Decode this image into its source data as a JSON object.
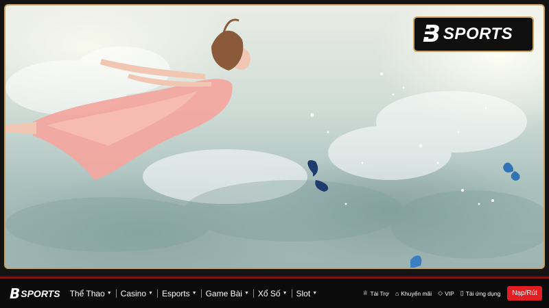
{
  "brand": {
    "mark": "B",
    "name": "SPORTS"
  },
  "hero": {
    "image": "woman-floating-in-clouds-with-butterflies",
    "accent_border": "#c9a35a"
  },
  "nav": {
    "menu": [
      {
        "label": "Thể Thao",
        "has_dropdown": true
      },
      {
        "label": "Casino",
        "has_dropdown": true
      },
      {
        "label": "Esports",
        "has_dropdown": true
      },
      {
        "label": "Game Bài",
        "has_dropdown": true
      },
      {
        "label": "Xổ Số",
        "has_dropdown": true
      },
      {
        "label": "Slot",
        "has_dropdown": true
      }
    ],
    "links": [
      {
        "label": "Tài Trợ",
        "icon": "trophy-icon"
      },
      {
        "label": "Khuyến mãi",
        "icon": "tag-icon"
      },
      {
        "label": "VIP",
        "icon": "diamond-icon"
      },
      {
        "label": "Tải ứng dụng",
        "icon": "phone-icon"
      }
    ],
    "cta": "Nạp/Rút",
    "cta_color": "#e01e24",
    "border_color": "#7a1616"
  }
}
